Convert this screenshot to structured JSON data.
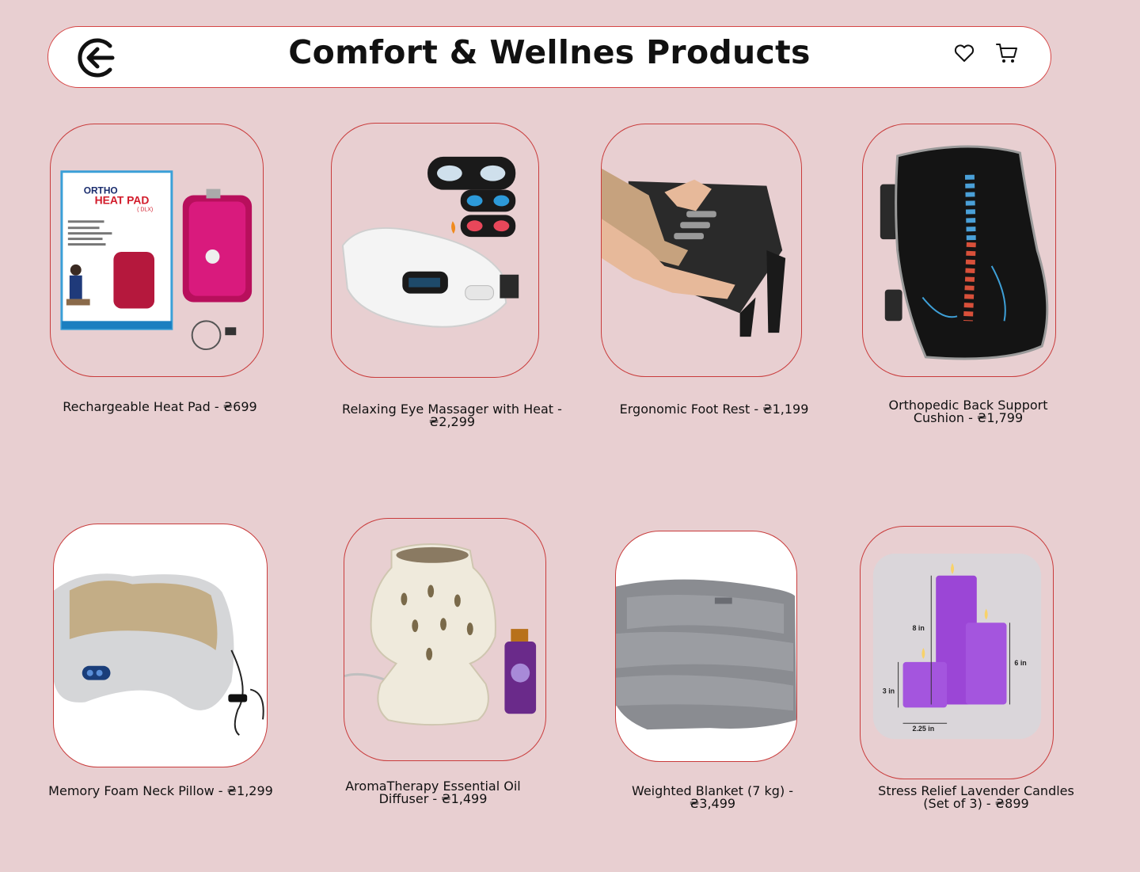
{
  "header": {
    "title": "Comfort & Wellnes Products",
    "back_icon": "arrow-left-circle-icon",
    "wishlist_icon": "heart-icon",
    "cart_icon": "shopping-cart-icon"
  },
  "products": [
    {
      "name": "Rechargeable Heat Pad - ₴699",
      "image_text": [
        "ORTHO",
        "HEAT PAD",
        "( DLX)"
      ]
    },
    {
      "name": "Relaxing Eye Massager with Heat -\n₴2,299"
    },
    {
      "name": "Ergonomic Foot Rest - ₴1,199"
    },
    {
      "name": "Orthopedic Back Support\nCushion - ₴1,799"
    },
    {
      "name": "Memory Foam Neck Pillow - ₴1,299"
    },
    {
      "name": "AromaTherapy Essential Oil\nDiffuser - ₴1,499"
    },
    {
      "name": "Weighted Blanket (7 kg) -\n₴3,499"
    },
    {
      "name": "Stress Relief Lavender Candles\n(Set of 3) - ₴899",
      "image_text": [
        "8 in",
        "6 in",
        "3 in",
        "2.25 in"
      ]
    }
  ],
  "colors": {
    "background": "#e8cfd1",
    "border": "#c93c3c",
    "header_bg": "#ffffff"
  }
}
